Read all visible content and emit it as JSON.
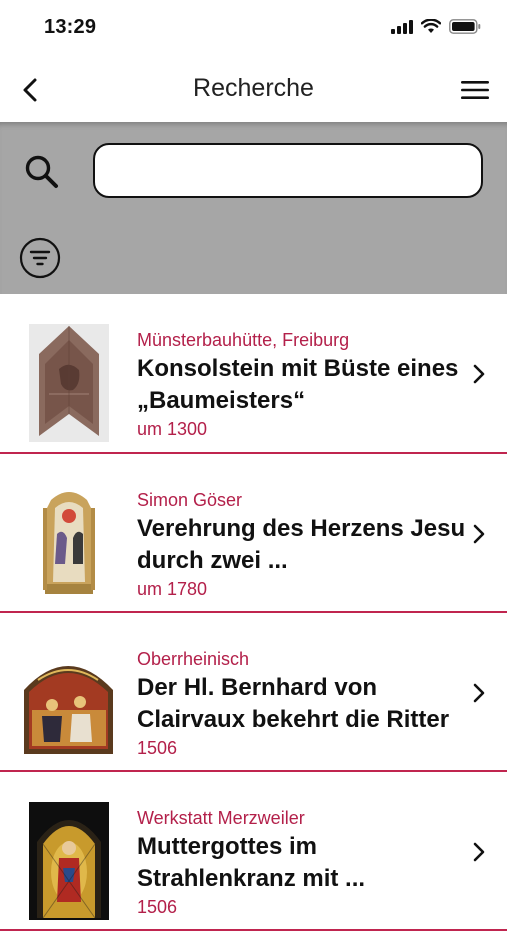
{
  "status": {
    "time": "13:29",
    "icons": [
      "signal-icon",
      "wifi-icon",
      "battery-icon"
    ]
  },
  "nav": {
    "title": "Recherche",
    "back_icon": "back-chevron-icon",
    "menu_icon": "hamburger-menu-icon"
  },
  "search": {
    "value": "",
    "placeholder": "",
    "icon": "search-icon",
    "filter_icon": "filter-icon"
  },
  "results": [
    {
      "artist": "Münsterbauhütte, Freiburg",
      "title": "Konsolstein mit Büste eines „Baumeisters“",
      "date": "um 1300"
    },
    {
      "artist": "Simon Göser",
      "title": "Verehrung des Herzens Jesu durch zwei ...",
      "date": "um 1780"
    },
    {
      "artist": "Oberrheinisch",
      "title": "Der Hl. Bernhard von Clairvaux bekehrt die Ritter",
      "date": "1506"
    },
    {
      "artist": "Werkstatt Merzweiler",
      "title": "Muttergottes im Strahlenkranz mit ...",
      "date": "1506"
    }
  ],
  "colors": {
    "accent": "#b3204a",
    "divider": "#c0254f",
    "search_panel": "#a6a6a6"
  }
}
